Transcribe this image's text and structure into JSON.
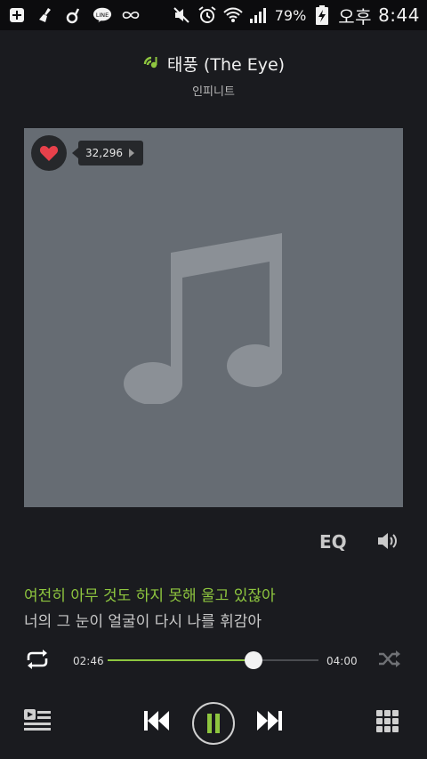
{
  "status_bar": {
    "battery": "79%",
    "ampm": "오후",
    "time": "8:44"
  },
  "now_playing": {
    "title": "태풍 (The Eye)",
    "artist": "인피니트",
    "likes": "32,296"
  },
  "controls": {
    "eq_label": "EQ",
    "current_time": "02:46",
    "total_time": "04:00",
    "progress": 0.69
  },
  "lyrics": {
    "current_line": "여전히 아무 것도 하지 못해 울고 있잖아",
    "next_line": "너의 그 눈이 얼굴이 다시 나를 휘감아"
  },
  "colors": {
    "accent": "#8ec63f",
    "background": "#1a1b1f",
    "album_art_placeholder": "#666c73",
    "heart": "#e8414b"
  },
  "icons": [
    "add-icon",
    "cleaner-icon",
    "music-app-icon",
    "line-icon",
    "infinity-icon",
    "mute-icon",
    "alarm-icon",
    "wifi-icon",
    "signal-icon",
    "battery-icon",
    "now-playing-icon",
    "heart-icon",
    "music-note-icon",
    "volume-icon",
    "repeat-icon",
    "shuffle-icon",
    "playlist-icon",
    "previous-icon",
    "pause-icon",
    "next-icon",
    "grid-menu-icon"
  ]
}
